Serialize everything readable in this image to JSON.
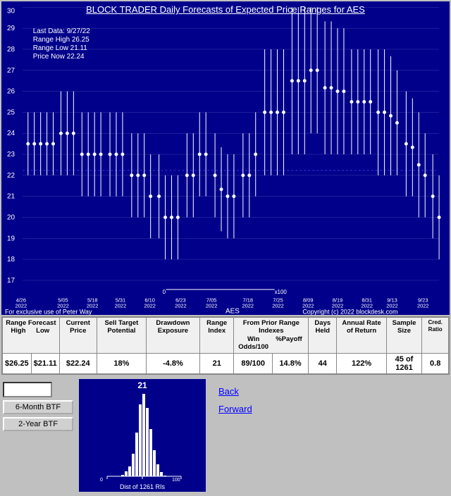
{
  "chart": {
    "title_prefix": "BLOCK TRADER Daily ",
    "title_link": "Forecasts",
    "title_suffix": " of Expected Price Ranges for  AES",
    "last_data": "Last Data: 9/27/22",
    "range_high": "Range High 26.25",
    "range_low": "Range Low  21.11",
    "price_now": "Price Now  22.24",
    "footer_left": "For exclusive use of Peter Way",
    "footer_right": "Copyright (c) 2022 blockdesk.com",
    "x_axis_label": "AES",
    "y_labels": [
      "17",
      "18",
      "19",
      "20",
      "21",
      "22",
      "23",
      "24",
      "25",
      "26",
      "27",
      "28",
      "29",
      "30"
    ],
    "x_dates": [
      "4/26\n2022",
      "5/05\n2022",
      "5/18\n2022",
      "5/31\n2022",
      "6/10\n2022",
      "6/23\n2022",
      "7/05\n2022",
      "7/18\n2022",
      "7/25\n2022",
      "8/09\n2022",
      "8/19\n2022",
      "8/31\n2022",
      "9/13\n2022",
      "9/23\n2022"
    ]
  },
  "table": {
    "headers": {
      "range_forecast": "Range Forecast",
      "high": "High",
      "low": "Low",
      "current_price": "Current Price",
      "sell_target": "Sell Target Potential",
      "drawdown": "Drawdown Exposure",
      "range_index": "Range Index",
      "from_prior": "From Prior Range Indexes",
      "win_odds": "Win Odds/100",
      "payoff": "%Payoff",
      "days_held": "Days Held",
      "annual_rate": "Annual Rate of Return",
      "sample_size": "Sample Size",
      "cred_ratio": "Cred. Ratio"
    },
    "values": {
      "high": "$26.25",
      "low": "$21.11",
      "current": "$22.24",
      "sell_target": "18%",
      "drawdown": "-4.8%",
      "range_index": "21",
      "win_odds": "89/100",
      "payoff": "14.8%",
      "days_held": "44",
      "annual_rate": "122%",
      "sample_size": "45 of 1261",
      "cred_ratio": "0.8"
    }
  },
  "btf": {
    "input_placeholder": "",
    "button_6m": "6-Month BTF",
    "button_2y": "2-Year BTF"
  },
  "histogram": {
    "label_top": "21",
    "label_bottom": "Dist of 1261 RIs"
  },
  "nav": {
    "back": "Back",
    "forward": "Forward"
  }
}
